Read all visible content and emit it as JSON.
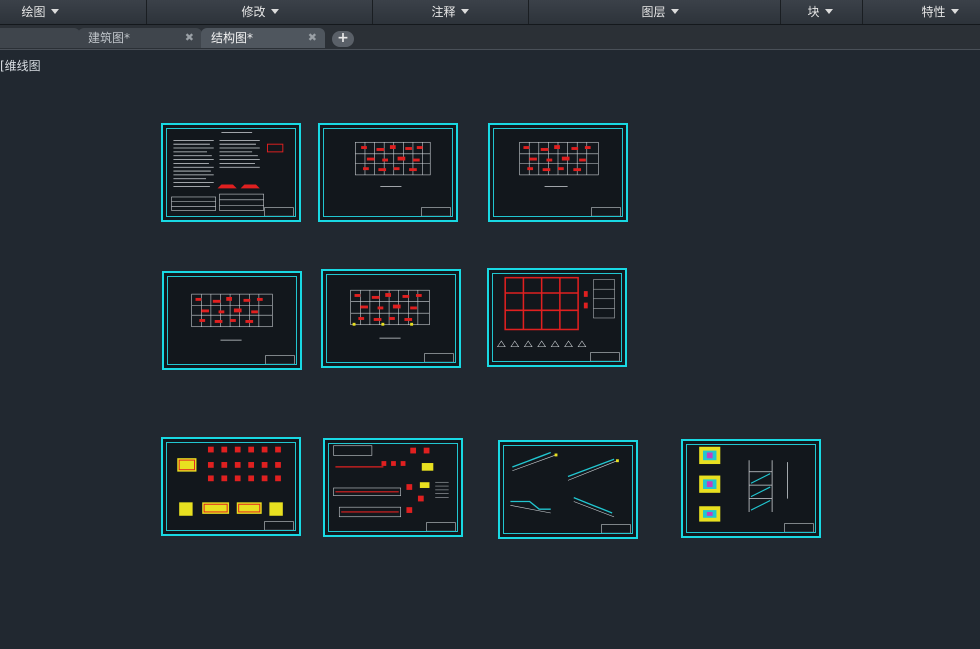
{
  "menubar": {
    "items": [
      {
        "label": "绘图"
      },
      {
        "label": "修改"
      },
      {
        "label": "注释"
      },
      {
        "label": "图层"
      },
      {
        "label": "块"
      },
      {
        "label": "特性"
      }
    ]
  },
  "tabs": [
    {
      "label": "建筑图*",
      "active": false
    },
    {
      "label": "结构图*",
      "active": true
    }
  ],
  "viewport": {
    "label": "[维线图"
  },
  "colors": {
    "sheet_border": "#19d9e3",
    "drawing_red": "#e02020",
    "background": "#212830"
  }
}
